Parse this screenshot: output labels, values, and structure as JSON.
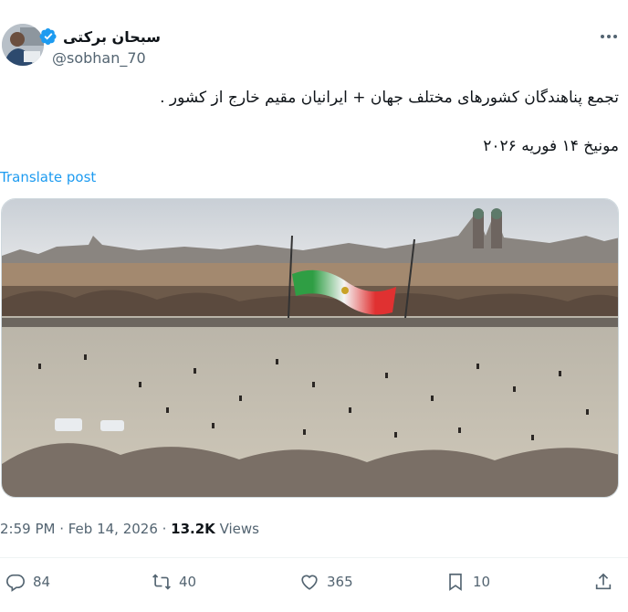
{
  "author": {
    "display_name": "سبحان برکتی",
    "handle": "@sobhan_70",
    "verified": true,
    "verified_color": "#1d9bf0"
  },
  "tweet": {
    "text": "تجمع پناهندگان کشورهای مختلف جهان + ایرانیان مقیم خارج از کشور .",
    "date_line": "مونیخ ۱۴ فوریه ۲۰۲۶",
    "translate_label": "Translate post"
  },
  "meta": {
    "time": "2:59 PM · Feb 14, 2026 · ",
    "views_count": "13.2K",
    "views_label": " Views"
  },
  "actions": {
    "replies": "84",
    "reposts": "40",
    "likes": "365",
    "bookmarks": "10"
  },
  "icons": {
    "more": "more-options-icon",
    "verified": "verified-badge-icon",
    "reply": "reply-icon",
    "repost": "repost-icon",
    "like": "like-icon",
    "bookmark": "bookmark-icon",
    "share": "share-icon"
  },
  "colors": {
    "text_primary": "#0f1419",
    "text_secondary": "#536471",
    "link": "#1d9bf0",
    "flag_green": "#2f9e44",
    "flag_red": "#e03131"
  }
}
